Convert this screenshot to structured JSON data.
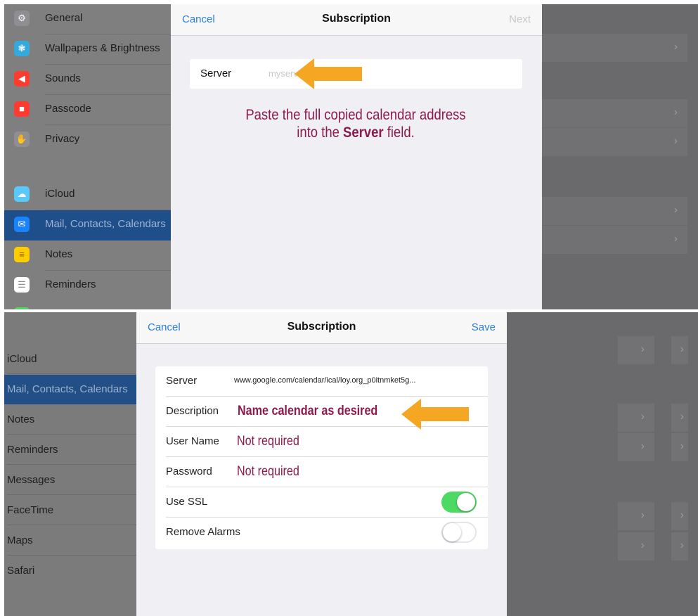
{
  "top": {
    "sidebar": {
      "items": [
        {
          "label": "General",
          "icon": "gear-icon",
          "color": "#8e8e93"
        },
        {
          "label": "Wallpapers & Brightness",
          "icon": "flower-icon",
          "color": "#34aadc"
        },
        {
          "label": "Sounds",
          "icon": "speaker-icon",
          "color": "#ff3b30"
        },
        {
          "label": "Passcode",
          "icon": "lock-icon",
          "color": "#ff3b30"
        },
        {
          "label": "Privacy",
          "icon": "hand-icon",
          "color": "#8e8e93"
        },
        {
          "label": "iCloud",
          "icon": "cloud-icon",
          "color": "#5ac8fa"
        },
        {
          "label": "Mail, Contacts, Calendars",
          "icon": "envelope-icon",
          "color": "#1a82fb",
          "selected": true
        },
        {
          "label": "Notes",
          "icon": "notepad-icon",
          "color": "#ffcc00"
        },
        {
          "label": "Reminders",
          "icon": "list-icon",
          "color": "#ffffff"
        }
      ]
    },
    "sheet": {
      "cancel": "Cancel",
      "title": "Subscription",
      "next": "Next",
      "server_label": "Server",
      "server_value": "myserver.com/cal.ics",
      "instruction_line1": "Paste the full copied calendar address",
      "instruction_line2_pre": "into the ",
      "instruction_line2_bold": "Server",
      "instruction_line2_post": " field."
    }
  },
  "bottom": {
    "sidebar": {
      "items": [
        {
          "label": "iCloud"
        },
        {
          "label": "Mail, Contacts, Calendars",
          "selected": true
        },
        {
          "label": "Notes"
        },
        {
          "label": "Reminders"
        },
        {
          "label": "Messages"
        },
        {
          "label": "FaceTime"
        },
        {
          "label": "Maps"
        },
        {
          "label": "Safari"
        }
      ]
    },
    "sheet": {
      "cancel": "Cancel",
      "title": "Subscription",
      "save": "Save",
      "server_label": "Server",
      "server_value": "www.google.com/calendar/ical/loy.org_p0itnmket5g...",
      "description_label": "Description",
      "description_annotation": "Name calendar as desired",
      "username_label": "User Name",
      "username_annotation": "Not required",
      "password_label": "Password",
      "password_annotation": "Not required",
      "use_ssl_label": "Use SSL",
      "use_ssl_on": true,
      "remove_alarms_label": "Remove Alarms",
      "remove_alarms_on": false
    }
  },
  "colors": {
    "ios_blue": "#2b7ed8",
    "annotation": "#8b1a4f",
    "arrow": "#f5a623",
    "toggle_on": "#4cd964",
    "next_disabled": "#c7c7cc"
  }
}
